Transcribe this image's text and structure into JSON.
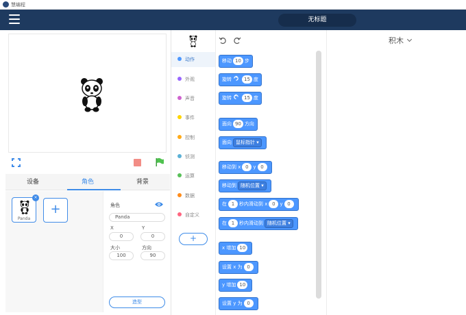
{
  "titlebar": {
    "app_name": "慧编程"
  },
  "topbar": {
    "project_title": "无标题"
  },
  "stage_tabs": [
    "设备",
    "角色",
    "背景"
  ],
  "sprite": {
    "name": "Panda"
  },
  "props": {
    "role_label": "角色",
    "name_value": "Panda",
    "x_label": "X",
    "x_value": "0",
    "y_label": "Y",
    "y_value": "0",
    "size_label": "大小",
    "size_value": "100",
    "dir_label": "方向",
    "dir_value": "90",
    "shape_button": "造型"
  },
  "categories": [
    {
      "label": "动作",
      "color": "#4c97ff"
    },
    {
      "label": "外观",
      "color": "#9966ff"
    },
    {
      "label": "声音",
      "color": "#cf63cf"
    },
    {
      "label": "事件",
      "color": "#ffd500"
    },
    {
      "label": "控制",
      "color": "#ffab19"
    },
    {
      "label": "侦测",
      "color": "#5cb1d6"
    },
    {
      "label": "运算",
      "color": "#59c059"
    },
    {
      "label": "数据",
      "color": "#ff8c1a"
    },
    {
      "label": "自定义",
      "color": "#ff6680"
    }
  ],
  "add_extension": "+",
  "blocks": {
    "move": {
      "a": "移动",
      "v": "10",
      "b": "步"
    },
    "turn_right": {
      "a": "旋转",
      "v": "15",
      "b": "度"
    },
    "turn_left": {
      "a": "旋转",
      "v": "15",
      "b": "度"
    },
    "point_dir": {
      "a": "面向",
      "v": "90",
      "b": "方向"
    },
    "point_to": {
      "a": "面向",
      "dd": "鼠标指针"
    },
    "goto_xy": {
      "a": "移动到 x",
      "v1": "0",
      "b": "y",
      "v2": "0"
    },
    "goto": {
      "a": "移动到",
      "dd": "随机位置"
    },
    "glide_xy": {
      "a": "在",
      "v1": "1",
      "b": "秒内滑动到 x",
      "v2": "0",
      "c": "y",
      "v3": "0"
    },
    "glide": {
      "a": "在",
      "v1": "1",
      "b": "秒内滑动到",
      "dd": "随机位置"
    },
    "change_x": {
      "a": "x 增加",
      "v": "10"
    },
    "set_x": {
      "a": "设置 x 为",
      "v": "0"
    },
    "change_y": {
      "a": "y 增加",
      "v": "10"
    },
    "set_y": {
      "a": "设置 y 为",
      "v": "0"
    }
  },
  "workspace": {
    "menu_label": "积木"
  },
  "colors": {
    "motion": "#4c97ff",
    "accent": "#3d8be8",
    "topbar": "#1e3a5f"
  }
}
